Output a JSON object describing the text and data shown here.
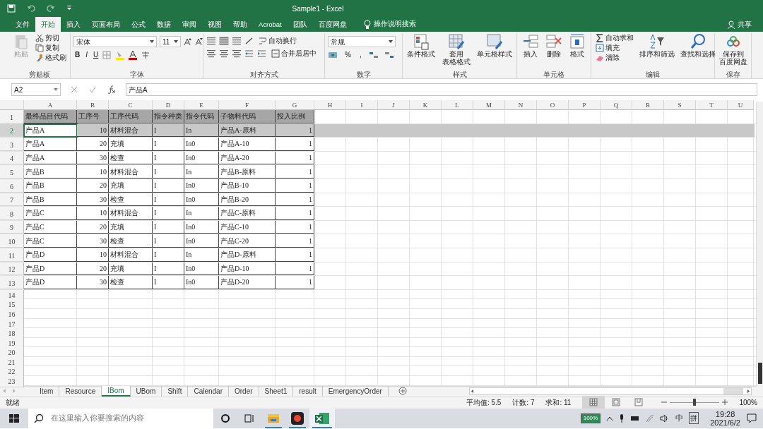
{
  "window": {
    "title": "Sample1 - Excel"
  },
  "ribbon_tabs": [
    {
      "label": "文件",
      "selected": false
    },
    {
      "label": "开始",
      "selected": true
    },
    {
      "label": "插入",
      "selected": false
    },
    {
      "label": "页面布局",
      "selected": false
    },
    {
      "label": "公式",
      "selected": false
    },
    {
      "label": "数据",
      "selected": false
    },
    {
      "label": "审阅",
      "selected": false
    },
    {
      "label": "视图",
      "selected": false
    },
    {
      "label": "帮助",
      "selected": false
    },
    {
      "label": "Acrobat",
      "selected": false
    },
    {
      "label": "团队",
      "selected": false
    },
    {
      "label": "百度网盘",
      "selected": false
    }
  ],
  "tell_me": "操作说明搜索",
  "share": "共享",
  "clipboard": {
    "label": "剪贴板",
    "paste": {
      "label": "粘贴",
      "disabled": true
    },
    "items": [
      "剪切",
      "复制",
      "格式刷"
    ]
  },
  "font": {
    "label": "字体",
    "font_name": "宋体",
    "font_size": "11",
    "format_buttons": [
      "B",
      "I",
      "U"
    ]
  },
  "alignment": {
    "label": "对齐方式",
    "wrap": "自动换行",
    "merge": "合并后居中"
  },
  "number": {
    "label": "数字",
    "format": "常规",
    "percent": "%",
    "comma": ","
  },
  "styles": {
    "label": "样式",
    "items": [
      {
        "lines": [
          "条件格式"
        ]
      },
      {
        "lines": [
          "套用",
          "表格格式"
        ]
      },
      {
        "lines": [
          "单元格样式"
        ]
      }
    ]
  },
  "cells": {
    "label": "单元格",
    "items": [
      "插入",
      "删除",
      "格式"
    ]
  },
  "editing": {
    "label": "编辑",
    "small_items": [
      "自动求和",
      "填充",
      "清除"
    ],
    "large_items": [
      "排序和筛选",
      "查找和选择"
    ]
  },
  "save": {
    "label": "保存",
    "lines": [
      "保存到",
      "百度网盘"
    ]
  },
  "name_box": "A2",
  "formula": "产品A",
  "columns": [
    "A",
    "B",
    "C",
    "D",
    "E",
    "F",
    "G",
    "H",
    "I",
    "J",
    "K",
    "L",
    "M",
    "N",
    "O",
    "P",
    "Q",
    "R",
    "S",
    "T",
    "U"
  ],
  "header_row": {
    "number": "1",
    "cells": [
      "最终品目代码",
      "工序号",
      "工序代码",
      "指令种类",
      "指令代码",
      "子物料代码",
      "投入比例"
    ]
  },
  "rows": [
    {
      "number": "2",
      "selected": true,
      "cells": [
        "产品A",
        "10",
        "材料混合",
        "I",
        "In",
        "产品A-原料",
        "1"
      ]
    },
    {
      "number": "3",
      "selected": false,
      "cells": [
        "产品A",
        "20",
        "充填",
        "I",
        "In0",
        "产品A-10",
        "1"
      ]
    },
    {
      "number": "4",
      "selected": false,
      "cells": [
        "产品A",
        "30",
        "检查",
        "I",
        "In0",
        "产品A-20",
        "1"
      ]
    },
    {
      "number": "5",
      "selected": false,
      "cells": [
        "产品B",
        "10",
        "材料混合",
        "I",
        "In",
        "产品B-原料",
        "1"
      ]
    },
    {
      "number": "6",
      "selected": false,
      "cells": [
        "产品B",
        "20",
        "充填",
        "I",
        "In0",
        "产品B-10",
        "1"
      ]
    },
    {
      "number": "7",
      "selected": false,
      "cells": [
        "产品B",
        "30",
        "检查",
        "I",
        "In0",
        "产品B-20",
        "1"
      ]
    },
    {
      "number": "8",
      "selected": false,
      "cells": [
        "产品C",
        "10",
        "材料混合",
        "I",
        "In",
        "产品C-原料",
        "1"
      ]
    },
    {
      "number": "9",
      "selected": false,
      "cells": [
        "产品C",
        "20",
        "充填",
        "I",
        "In0",
        "产品C-10",
        "1"
      ]
    },
    {
      "number": "10",
      "selected": false,
      "cells": [
        "产品C",
        "30",
        "检查",
        "I",
        "In0",
        "产品C-20",
        "1"
      ]
    },
    {
      "number": "11",
      "selected": false,
      "cells": [
        "产品D",
        "10",
        "材料混合",
        "I",
        "In",
        "产品D-原料",
        "1"
      ]
    },
    {
      "number": "12",
      "selected": false,
      "cells": [
        "产品D",
        "20",
        "充填",
        "I",
        "In0",
        "产品D-10",
        "1"
      ]
    },
    {
      "number": "13",
      "selected": false,
      "cells": [
        "产品D",
        "30",
        "检查",
        "I",
        "In0",
        "产品D-20",
        "1"
      ]
    },
    {
      "number": "14",
      "selected": false
    },
    {
      "number": "15",
      "selected": false
    },
    {
      "number": "16",
      "selected": false
    },
    {
      "number": "17",
      "selected": false
    },
    {
      "number": "18",
      "selected": false
    },
    {
      "number": "19",
      "selected": false
    },
    {
      "number": "20",
      "selected": false
    },
    {
      "number": "21",
      "selected": false
    },
    {
      "number": "22",
      "selected": false
    },
    {
      "number": "23",
      "selected": false
    }
  ],
  "sheet_tabs": [
    {
      "label": "Item",
      "selected": false
    },
    {
      "label": "Resource",
      "selected": false
    },
    {
      "label": "IBom",
      "selected": true
    },
    {
      "label": "UBom",
      "selected": false
    },
    {
      "label": "Shift",
      "selected": false
    },
    {
      "label": "Calendar",
      "selected": false
    },
    {
      "label": "Order",
      "selected": false
    },
    {
      "label": "Sheet1",
      "selected": false
    },
    {
      "label": "result",
      "selected": false
    },
    {
      "label": "EmergencyOrder",
      "selected": false
    }
  ],
  "status_bar": {
    "ready": "就绪",
    "average": "平均值: 5.5",
    "count": "计数: 7",
    "sum": "求和: 11",
    "views": [
      {
        "selected": true
      },
      {
        "selected": false
      },
      {
        "selected": false
      }
    ],
    "zoom_slider": {
      "level": 0.5
    },
    "zoom": "100%"
  },
  "taskbar": {
    "search": {
      "placeholder": "在这里输入你要搜索的内容"
    },
    "battery": "100%",
    "ime": "中",
    "ime_mode": "拼",
    "time": "19:28",
    "date": "2021/6/2"
  }
}
